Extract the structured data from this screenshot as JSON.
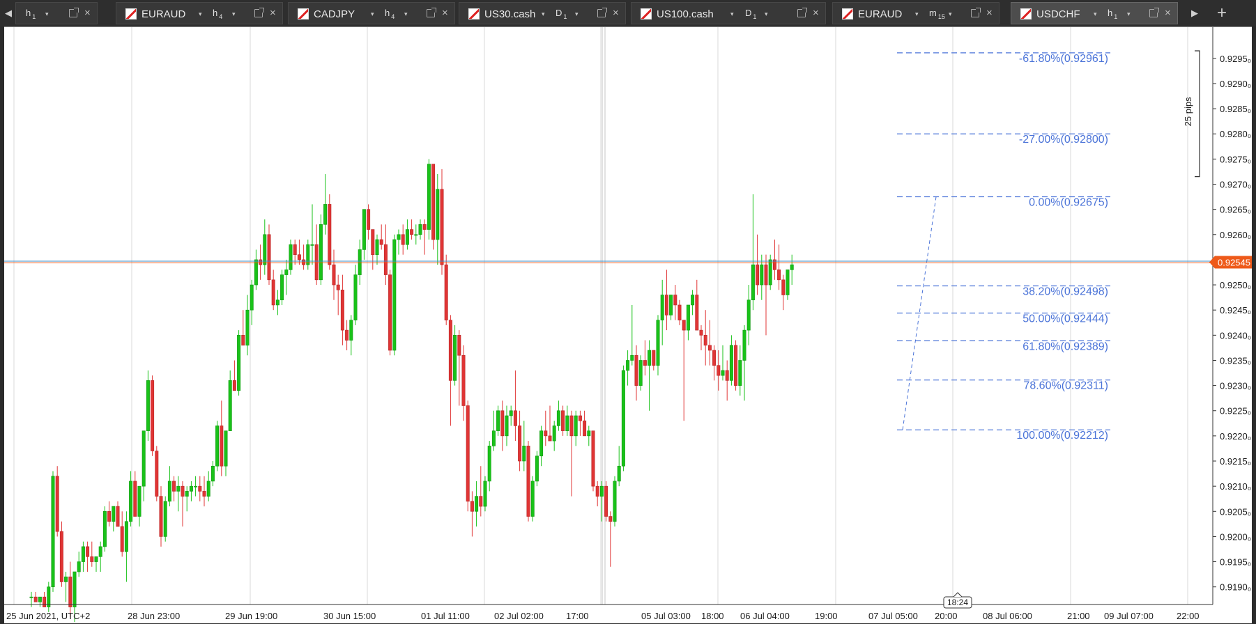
{
  "tabbar": {
    "tabs": [
      {
        "symbol": "",
        "timeframe": "h",
        "timeframe_sub": "1",
        "active": false
      },
      {
        "symbol": "EURAUD",
        "timeframe": "h",
        "timeframe_sub": "4",
        "active": false
      },
      {
        "symbol": "CADJPY",
        "timeframe": "h",
        "timeframe_sub": "4",
        "active": false
      },
      {
        "symbol": "US30.cash",
        "timeframe": "D",
        "timeframe_sub": "1",
        "active": false
      },
      {
        "symbol": "US100.cash",
        "timeframe": "D",
        "timeframe_sub": "1",
        "active": false
      },
      {
        "symbol": "EURAUD",
        "timeframe": "m",
        "timeframe_sub": "15",
        "active": false
      },
      {
        "symbol": "USDCHF",
        "timeframe": "h",
        "timeframe_sub": "1",
        "active": true
      }
    ],
    "left_arrow": "◀",
    "right_arrow": "▶",
    "add_tab": "+",
    "caret": "▾",
    "close": "×"
  },
  "chart_data": {
    "type": "candlestick",
    "symbol": "USDCHF",
    "timeframe": "h1",
    "y_axis": {
      "ticks": [
        "0.9295₀",
        "0.9290₀",
        "0.9285₀",
        "0.9280₀",
        "0.9275₀",
        "0.9270₀",
        "0.9265₀",
        "0.9260₀",
        "0.9255₀",
        "0.9250₀",
        "0.9245₀",
        "0.9240₀",
        "0.9235₀",
        "0.9230₀",
        "0.9225₀",
        "0.9220₀",
        "0.9215₀",
        "0.9210₀",
        "0.9205₀",
        "0.9200₀",
        "0.9195₀",
        "0.9190₀"
      ],
      "tick_values": [
        0.9295,
        0.929,
        0.9285,
        0.928,
        0.9275,
        0.927,
        0.9265,
        0.926,
        0.9255,
        0.925,
        0.9245,
        0.924,
        0.9235,
        0.923,
        0.9225,
        0.922,
        0.9215,
        0.921,
        0.9205,
        0.92,
        0.9195,
        0.919
      ],
      "range": [
        0.91865,
        0.93012
      ]
    },
    "x_axis": {
      "labels": [
        "25 Jun 2021, UTC+2",
        "28 Jun 23:00",
        "29 Jun 19:00",
        "30 Jun 15:00",
        "01 Jul 11:00",
        "02 Jul 02:00",
        "17:00",
        "05 Jul 03:00",
        "18:00",
        "06 Jul 04:00",
        "19:00",
        "07 Jul 05:00",
        "20:00",
        "08 Jul 06:00",
        "21:00",
        "09 Jul 07:00",
        "22:00"
      ],
      "current_time_label": "18:24"
    },
    "current_price": {
      "label": "0.92545",
      "value": 0.92545,
      "color": "#ee5a1a"
    },
    "pip_ruler": {
      "label": "25 pips"
    },
    "fibonacci": [
      {
        "label": "-61.80%(0.92961)",
        "price": 0.92961
      },
      {
        "label": "-27.00%(0.92800)",
        "price": 0.928
      },
      {
        "label": "0.00%(0.92675)",
        "price": 0.92675
      },
      {
        "label": "38.20%(0.92498)",
        "price": 0.92498
      },
      {
        "label": "50.00%(0.92444)",
        "price": 0.92444
      },
      {
        "label": "61.80%(0.92389)",
        "price": 0.92389
      },
      {
        "label": "78.60%(0.92311)",
        "price": 0.92311
      },
      {
        "label": "100.00%(0.92212)",
        "price": 0.92212
      }
    ],
    "fib_anchor": {
      "low": 0.92212,
      "high": 0.92675
    },
    "colors": {
      "bull": "#19c219",
      "bear": "#e03535",
      "fib": "#4a73d8",
      "grid": "#d8d8d8"
    },
    "ohlc_series": [
      [
        0.9188,
        0.9189,
        0.9186,
        0.9188
      ],
      [
        0.9188,
        0.9189,
        0.9187,
        0.9187
      ],
      [
        0.9187,
        0.9188,
        0.9186,
        0.9188
      ],
      [
        0.9188,
        0.9189,
        0.9186,
        0.9186
      ],
      [
        0.9186,
        0.9191,
        0.9185,
        0.919
      ],
      [
        0.919,
        0.9213,
        0.9189,
        0.9212
      ],
      [
        0.9212,
        0.9214,
        0.92,
        0.9201
      ],
      [
        0.9201,
        0.9203,
        0.919,
        0.9191
      ],
      [
        0.9191,
        0.9193,
        0.9187,
        0.9192
      ],
      [
        0.9192,
        0.9195,
        0.9184,
        0.9186
      ],
      [
        0.9186,
        0.9193,
        0.9183,
        0.9193
      ],
      [
        0.9193,
        0.9197,
        0.9192,
        0.9195
      ],
      [
        0.9195,
        0.9199,
        0.9193,
        0.9198
      ],
      [
        0.9198,
        0.9199,
        0.9193,
        0.9196
      ],
      [
        0.9196,
        0.9199,
        0.9194,
        0.9195
      ],
      [
        0.9195,
        0.9196,
        0.9193,
        0.9196
      ],
      [
        0.9196,
        0.9199,
        0.9193,
        0.9198
      ],
      [
        0.9198,
        0.9206,
        0.9197,
        0.9205
      ],
      [
        0.9205,
        0.9207,
        0.9202,
        0.9203
      ],
      [
        0.9203,
        0.9206,
        0.9201,
        0.9206
      ],
      [
        0.9206,
        0.9207,
        0.9203,
        0.9202
      ],
      [
        0.9202,
        0.9205,
        0.9196,
        0.9197
      ],
      [
        0.9197,
        0.9205,
        0.9191,
        0.9203
      ],
      [
        0.9203,
        0.9213,
        0.9202,
        0.9211
      ],
      [
        0.9211,
        0.9213,
        0.9204,
        0.9204
      ],
      [
        0.9204,
        0.921,
        0.9202,
        0.921
      ],
      [
        0.921,
        0.9221,
        0.9207,
        0.9221
      ],
      [
        0.9221,
        0.9233,
        0.9219,
        0.9231
      ],
      [
        0.9231,
        0.9232,
        0.9216,
        0.9217
      ],
      [
        0.9217,
        0.9218,
        0.9207,
        0.9208
      ],
      [
        0.9208,
        0.921,
        0.9198,
        0.92
      ],
      [
        0.92,
        0.9208,
        0.9199,
        0.9207
      ],
      [
        0.9207,
        0.9214,
        0.9206,
        0.9211
      ],
      [
        0.9211,
        0.9212,
        0.9207,
        0.9209
      ],
      [
        0.9209,
        0.9212,
        0.9205,
        0.921
      ],
      [
        0.921,
        0.9211,
        0.9202,
        0.9208
      ],
      [
        0.9208,
        0.921,
        0.9205,
        0.9209
      ],
      [
        0.9209,
        0.9211,
        0.9207,
        0.921
      ],
      [
        0.921,
        0.9212,
        0.9208,
        0.921
      ],
      [
        0.921,
        0.9212,
        0.9207,
        0.9209
      ],
      [
        0.9209,
        0.9212,
        0.9206,
        0.9208
      ],
      [
        0.9208,
        0.9213,
        0.9207,
        0.9211
      ],
      [
        0.9211,
        0.9215,
        0.921,
        0.9214
      ],
      [
        0.9214,
        0.9223,
        0.9213,
        0.9222
      ],
      [
        0.9222,
        0.9227,
        0.9212,
        0.9214
      ],
      [
        0.9214,
        0.922,
        0.9212,
        0.9221
      ],
      [
        0.9221,
        0.9233,
        0.9221,
        0.9231
      ],
      [
        0.9231,
        0.9235,
        0.9229,
        0.9229
      ],
      [
        0.9229,
        0.9241,
        0.9228,
        0.924
      ],
      [
        0.924,
        0.9245,
        0.9238,
        0.9238
      ],
      [
        0.9238,
        0.9248,
        0.9236,
        0.9245
      ],
      [
        0.9245,
        0.9251,
        0.9242,
        0.925
      ],
      [
        0.925,
        0.9257,
        0.9249,
        0.9255
      ],
      [
        0.9255,
        0.9258,
        0.9251,
        0.9254
      ],
      [
        0.9254,
        0.9263,
        0.9252,
        0.926
      ],
      [
        0.926,
        0.9262,
        0.925,
        0.9251
      ],
      [
        0.9251,
        0.9253,
        0.9245,
        0.9246
      ],
      [
        0.9246,
        0.9249,
        0.9244,
        0.9247
      ],
      [
        0.9247,
        0.9253,
        0.9246,
        0.9252
      ],
      [
        0.9252,
        0.9255,
        0.9248,
        0.9253
      ],
      [
        0.9253,
        0.9259,
        0.9252,
        0.9258
      ],
      [
        0.9258,
        0.9259,
        0.9254,
        0.9256
      ],
      [
        0.9256,
        0.9259,
        0.9254,
        0.9255
      ],
      [
        0.9255,
        0.9258,
        0.9253,
        0.9254
      ],
      [
        0.9254,
        0.9259,
        0.9253,
        0.9258
      ],
      [
        0.9258,
        0.9266,
        0.9254,
        0.9258
      ],
      [
        0.9258,
        0.9262,
        0.925,
        0.9251
      ],
      [
        0.9251,
        0.9264,
        0.925,
        0.9262
      ],
      [
        0.9262,
        0.9272,
        0.926,
        0.9266
      ],
      [
        0.9266,
        0.9268,
        0.9253,
        0.9254
      ],
      [
        0.9254,
        0.9257,
        0.9247,
        0.925
      ],
      [
        0.925,
        0.9252,
        0.9244,
        0.9249
      ],
      [
        0.9249,
        0.9252,
        0.9238,
        0.9241
      ],
      [
        0.9241,
        0.9243,
        0.9237,
        0.9239
      ],
      [
        0.9239,
        0.9244,
        0.9236,
        0.9243
      ],
      [
        0.9243,
        0.9254,
        0.9242,
        0.9252
      ],
      [
        0.9252,
        0.9259,
        0.925,
        0.9257
      ],
      [
        0.9257,
        0.9265,
        0.9255,
        0.9265
      ],
      [
        0.9265,
        0.9266,
        0.9259,
        0.9261
      ],
      [
        0.9261,
        0.9261,
        0.9253,
        0.9256
      ],
      [
        0.9256,
        0.926,
        0.9254,
        0.9259
      ],
      [
        0.9259,
        0.9262,
        0.9257,
        0.9258
      ],
      [
        0.9258,
        0.9262,
        0.925,
        0.9252
      ],
      [
        0.9252,
        0.9253,
        0.9236,
        0.9237
      ],
      [
        0.9237,
        0.926,
        0.9236,
        0.9259
      ],
      [
        0.9259,
        0.9261,
        0.9256,
        0.926
      ],
      [
        0.926,
        0.9262,
        0.9256,
        0.9258
      ],
      [
        0.9258,
        0.9263,
        0.9257,
        0.9261
      ],
      [
        0.9261,
        0.9263,
        0.9259,
        0.926
      ],
      [
        0.926,
        0.9262,
        0.9258,
        0.926
      ],
      [
        0.926,
        0.9263,
        0.9259,
        0.9262
      ],
      [
        0.9262,
        0.9263,
        0.9256,
        0.9261
      ],
      [
        0.9261,
        0.9275,
        0.9259,
        0.9274
      ],
      [
        0.9274,
        0.9274,
        0.9257,
        0.9259
      ],
      [
        0.9259,
        0.9272,
        0.9254,
        0.9269
      ],
      [
        0.9269,
        0.9273,
        0.9252,
        0.9254
      ],
      [
        0.9254,
        0.9256,
        0.9242,
        0.9243
      ],
      [
        0.9243,
        0.9244,
        0.9222,
        0.9231
      ],
      [
        0.9231,
        0.9242,
        0.923,
        0.924
      ],
      [
        0.924,
        0.9241,
        0.9226,
        0.9236
      ],
      [
        0.9236,
        0.9238,
        0.9223,
        0.9226
      ],
      [
        0.9226,
        0.9227,
        0.9205,
        0.9207
      ],
      [
        0.9207,
        0.9209,
        0.92,
        0.9205
      ],
      [
        0.9205,
        0.9211,
        0.9202,
        0.9208
      ],
      [
        0.9208,
        0.9214,
        0.9204,
        0.9206
      ],
      [
        0.9206,
        0.9212,
        0.9205,
        0.9211
      ],
      [
        0.9211,
        0.9219,
        0.9209,
        0.9218
      ],
      [
        0.9218,
        0.9225,
        0.9217,
        0.9221
      ],
      [
        0.9221,
        0.9226,
        0.922,
        0.9225
      ],
      [
        0.9225,
        0.9227,
        0.9217,
        0.922
      ],
      [
        0.922,
        0.9226,
        0.9218,
        0.9224
      ],
      [
        0.9224,
        0.9226,
        0.9222,
        0.9225
      ],
      [
        0.9225,
        0.9233,
        0.9219,
        0.9222
      ],
      [
        0.9222,
        0.9225,
        0.9213,
        0.9215
      ],
      [
        0.9215,
        0.9223,
        0.9213,
        0.9218
      ],
      [
        0.9218,
        0.9219,
        0.9203,
        0.9204
      ],
      [
        0.9204,
        0.9212,
        0.9203,
        0.9211
      ],
      [
        0.9211,
        0.9217,
        0.921,
        0.9216
      ],
      [
        0.9216,
        0.9222,
        0.9214,
        0.9221
      ],
      [
        0.9221,
        0.9225,
        0.9218,
        0.922
      ],
      [
        0.922,
        0.9226,
        0.9219,
        0.9219
      ],
      [
        0.9219,
        0.9223,
        0.9217,
        0.9222
      ],
      [
        0.9222,
        0.9227,
        0.9221,
        0.9225
      ],
      [
        0.9225,
        0.9226,
        0.922,
        0.9221
      ],
      [
        0.9221,
        0.9226,
        0.922,
        0.9224
      ],
      [
        0.9224,
        0.9225,
        0.9208,
        0.922
      ],
      [
        0.922,
        0.9225,
        0.9218,
        0.9224
      ],
      [
        0.9224,
        0.9225,
        0.922,
        0.9223
      ],
      [
        0.9223,
        0.9225,
        0.922,
        0.922
      ],
      [
        0.922,
        0.9222,
        0.9218,
        0.9221
      ],
      [
        0.9221,
        0.9221,
        0.9209,
        0.921
      ],
      [
        0.921,
        0.9211,
        0.9206,
        0.9208
      ],
      [
        0.9208,
        0.9211,
        0.9203,
        0.921
      ],
      [
        0.921,
        0.9211,
        0.9203,
        0.9204
      ],
      [
        0.9204,
        0.9205,
        0.9194,
        0.9203
      ],
      [
        0.9203,
        0.9212,
        0.9202,
        0.9211
      ],
      [
        0.9211,
        0.9218,
        0.921,
        0.9214
      ],
      [
        0.9214,
        0.9234,
        0.9213,
        0.9233
      ],
      [
        0.9233,
        0.9237,
        0.923,
        0.9235
      ],
      [
        0.9235,
        0.9246,
        0.9234,
        0.9236
      ],
      [
        0.9236,
        0.9238,
        0.9227,
        0.923
      ],
      [
        0.923,
        0.9236,
        0.9229,
        0.9235
      ],
      [
        0.9235,
        0.9239,
        0.9232,
        0.9234
      ],
      [
        0.9234,
        0.9239,
        0.9225,
        0.9237
      ],
      [
        0.9237,
        0.9237,
        0.9233,
        0.9234
      ],
      [
        0.9234,
        0.9244,
        0.9232,
        0.9243
      ],
      [
        0.9243,
        0.9251,
        0.9238,
        0.9248
      ],
      [
        0.9248,
        0.9253,
        0.9241,
        0.9244
      ],
      [
        0.9244,
        0.9248,
        0.9243,
        0.9248
      ],
      [
        0.9248,
        0.925,
        0.9243,
        0.9246
      ],
      [
        0.9246,
        0.9247,
        0.9242,
        0.9243
      ],
      [
        0.9243,
        0.9243,
        0.9223,
        0.9241
      ],
      [
        0.9241,
        0.9244,
        0.9239,
        0.9246
      ],
      [
        0.9246,
        0.9249,
        0.9244,
        0.9248
      ],
      [
        0.9248,
        0.9251,
        0.9241,
        0.9241
      ],
      [
        0.9241,
        0.9242,
        0.9237,
        0.924
      ],
      [
        0.924,
        0.9245,
        0.9234,
        0.9238
      ],
      [
        0.9238,
        0.9243,
        0.9234,
        0.9237
      ],
      [
        0.9237,
        0.9238,
        0.9231,
        0.9234
      ],
      [
        0.9234,
        0.9237,
        0.9229,
        0.9232
      ],
      [
        0.9232,
        0.9238,
        0.9231,
        0.9233
      ],
      [
        0.9233,
        0.9235,
        0.9227,
        0.9231
      ],
      [
        0.9231,
        0.924,
        0.923,
        0.9238
      ],
      [
        0.9238,
        0.9239,
        0.9229,
        0.923
      ],
      [
        0.923,
        0.9238,
        0.9228,
        0.9235
      ],
      [
        0.9235,
        0.9242,
        0.9227,
        0.9241
      ],
      [
        0.9241,
        0.925,
        0.9238,
        0.9247
      ],
      [
        0.9247,
        0.9268,
        0.9245,
        0.9254
      ],
      [
        0.9254,
        0.926,
        0.9248,
        0.925
      ],
      [
        0.925,
        0.9256,
        0.9247,
        0.9254
      ],
      [
        0.9254,
        0.9256,
        0.924,
        0.925
      ],
      [
        0.925,
        0.9256,
        0.9249,
        0.9255
      ],
      [
        0.9255,
        0.9259,
        0.9251,
        0.9253
      ],
      [
        0.9253,
        0.9258,
        0.9249,
        0.9251
      ],
      [
        0.9251,
        0.9252,
        0.9245,
        0.9248
      ],
      [
        0.9248,
        0.9253,
        0.9247,
        0.9253
      ],
      [
        0.9253,
        0.9256,
        0.925,
        0.9254
      ]
    ]
  }
}
